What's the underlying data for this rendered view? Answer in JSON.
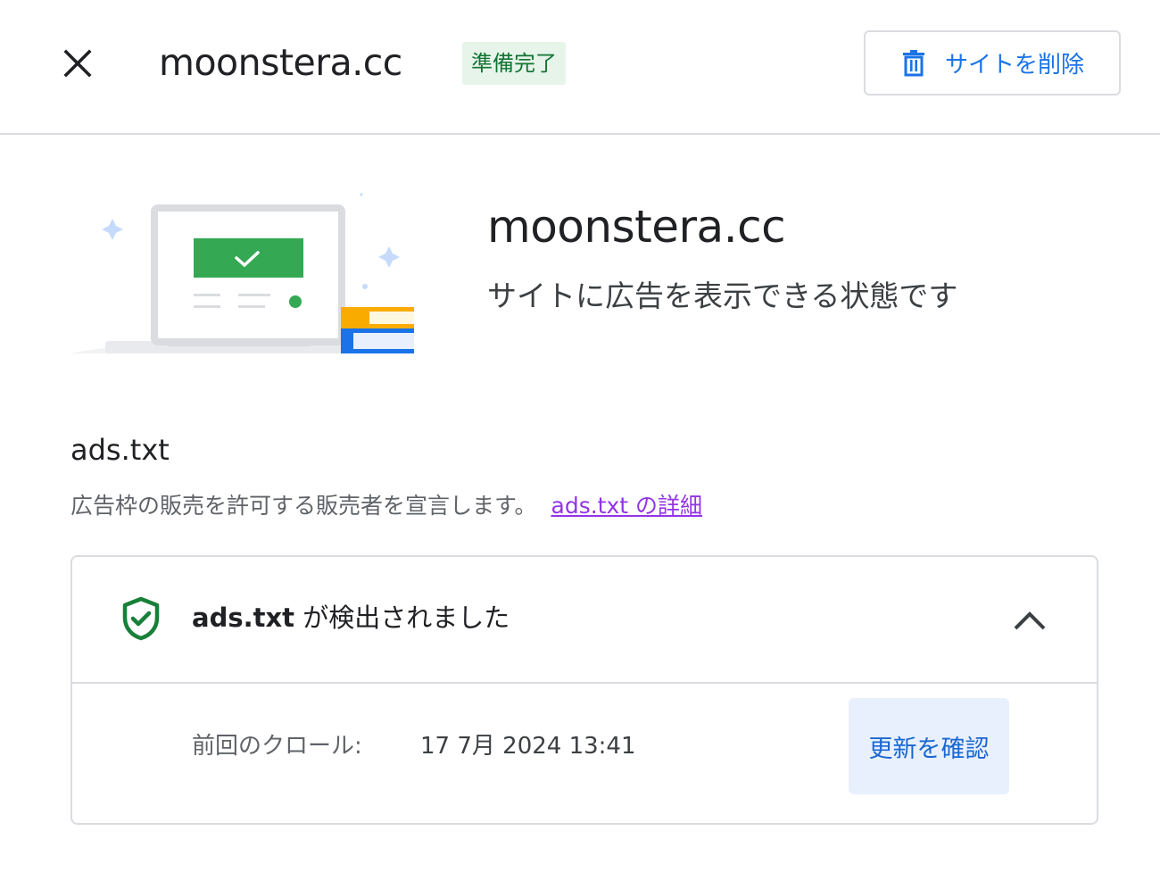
{
  "header": {
    "site_name": "moonstera.cc",
    "status_badge": "準備完了",
    "delete_button_label": "サイトを削除"
  },
  "hero": {
    "title": "moonstera.cc",
    "subtitle": "サイトに広告を表示できる状態です"
  },
  "ads_txt": {
    "title": "ads.txt",
    "description": "広告枠の販売を許可する販売者を宣言します。",
    "details_link": "ads.txt の詳細",
    "card": {
      "status_bold": "ads.txt",
      "status_rest": " が検出されました",
      "last_crawl_label": "前回のクロール:",
      "last_crawl_value": "17 7月 2024 13:41",
      "check_updates_button": "更新を確認"
    }
  },
  "icons": {
    "close": "close-icon",
    "delete": "trash-icon",
    "status": "shield-check-icon",
    "collapse": "chevron-up-icon"
  },
  "colors": {
    "accent": "#1a73e8",
    "success": "#137333",
    "success_bg": "#e6f4ea",
    "link": "#9334e6",
    "button_bg": "#e8f0fe"
  }
}
